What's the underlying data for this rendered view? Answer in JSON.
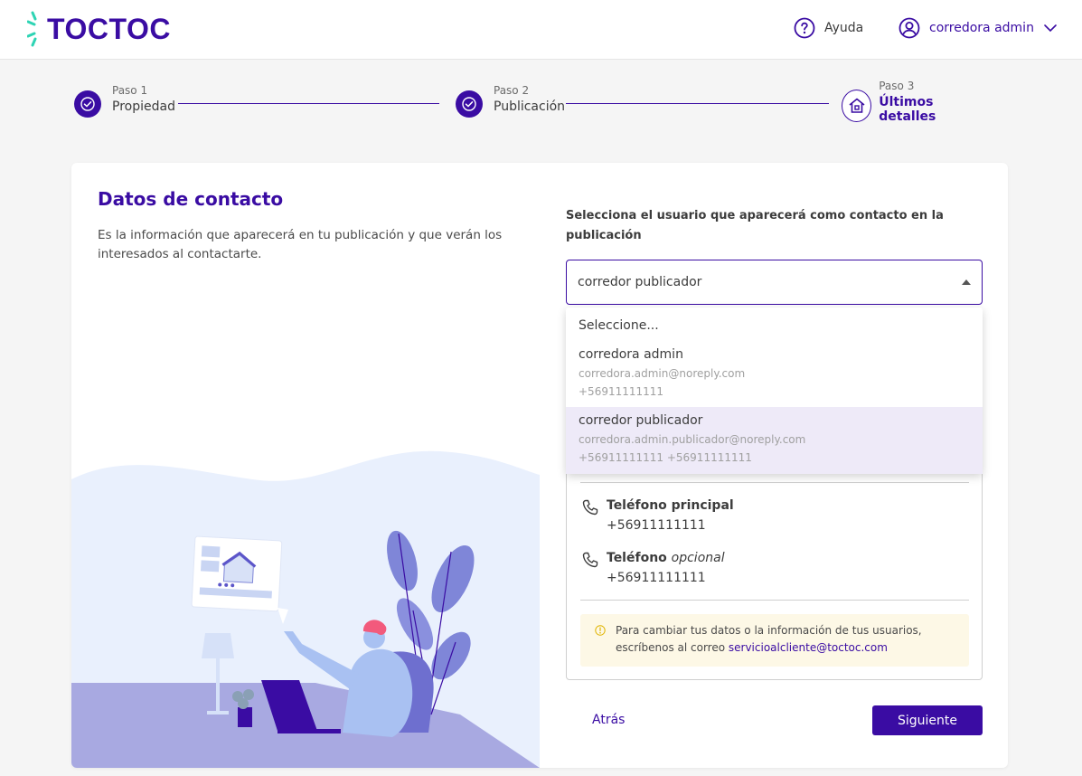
{
  "brand": {
    "logo_text": "TOCTOC",
    "primary": "#3a0ca3",
    "accent": "#2ed4b4"
  },
  "header": {
    "help_label": "Ayuda",
    "user_label": "corredora admin"
  },
  "stepper": {
    "steps": [
      {
        "num": "Paso 1",
        "name": "Propiedad",
        "state": "done"
      },
      {
        "num": "Paso 2",
        "name": "Publicación",
        "state": "done"
      },
      {
        "num": "Paso 3",
        "name": "Últimos detalles",
        "state": "current"
      }
    ]
  },
  "left": {
    "title": "Datos de contacto",
    "description": "Es la información que aparecerá en tu publicación y que verán los interesados al contactarte."
  },
  "right": {
    "select_label": "Selecciona el usuario que aparecerá como contacto en la publicación",
    "select_value": "corredor publicador",
    "options": [
      {
        "name": "Seleccione...",
        "email": "",
        "phone": ""
      },
      {
        "name": "corredora admin",
        "email": "corredora.admin@noreply.com",
        "phone": "+56911111111"
      },
      {
        "name": "corredor publicador",
        "email": "corredora.admin.publicador@noreply.com",
        "phone": "+56911111111 +56911111111"
      }
    ],
    "phone_main_label": "Teléfono principal",
    "phone_main_value": "+56911111111",
    "phone_opt_label": "Teléfono",
    "phone_opt_word": "opcional",
    "phone_opt_value": "+56911111111",
    "notice_text": "Para cambiar tus datos o la información de tus usuarios, escríbenos al correo ",
    "notice_link": "servicioalcliente@toctoc.com"
  },
  "actions": {
    "back_label": "Atrás",
    "next_label": "Siguiente"
  }
}
